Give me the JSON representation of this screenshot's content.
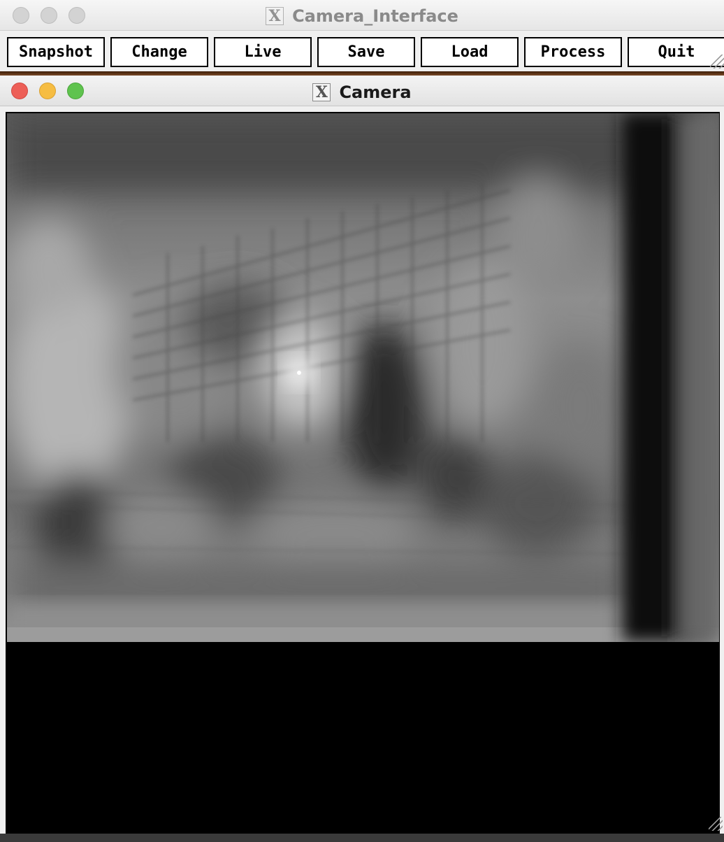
{
  "interface_window": {
    "title": "Camera_Interface",
    "title_icon": "x11-icon",
    "buttons": [
      {
        "label": "Snapshot"
      },
      {
        "label": "Change"
      },
      {
        "label": "Live"
      },
      {
        "label": "Save"
      },
      {
        "label": "Load"
      },
      {
        "label": "Process"
      },
      {
        "label": "Quit"
      }
    ]
  },
  "camera_window": {
    "title": "Camera",
    "title_icon": "x11-icon",
    "image_description_icon": "camera-frame",
    "colors": {
      "close": "#ed5f57",
      "minimize": "#f6bd42",
      "zoom": "#5fc34e",
      "canvas_background": "#000000"
    }
  }
}
